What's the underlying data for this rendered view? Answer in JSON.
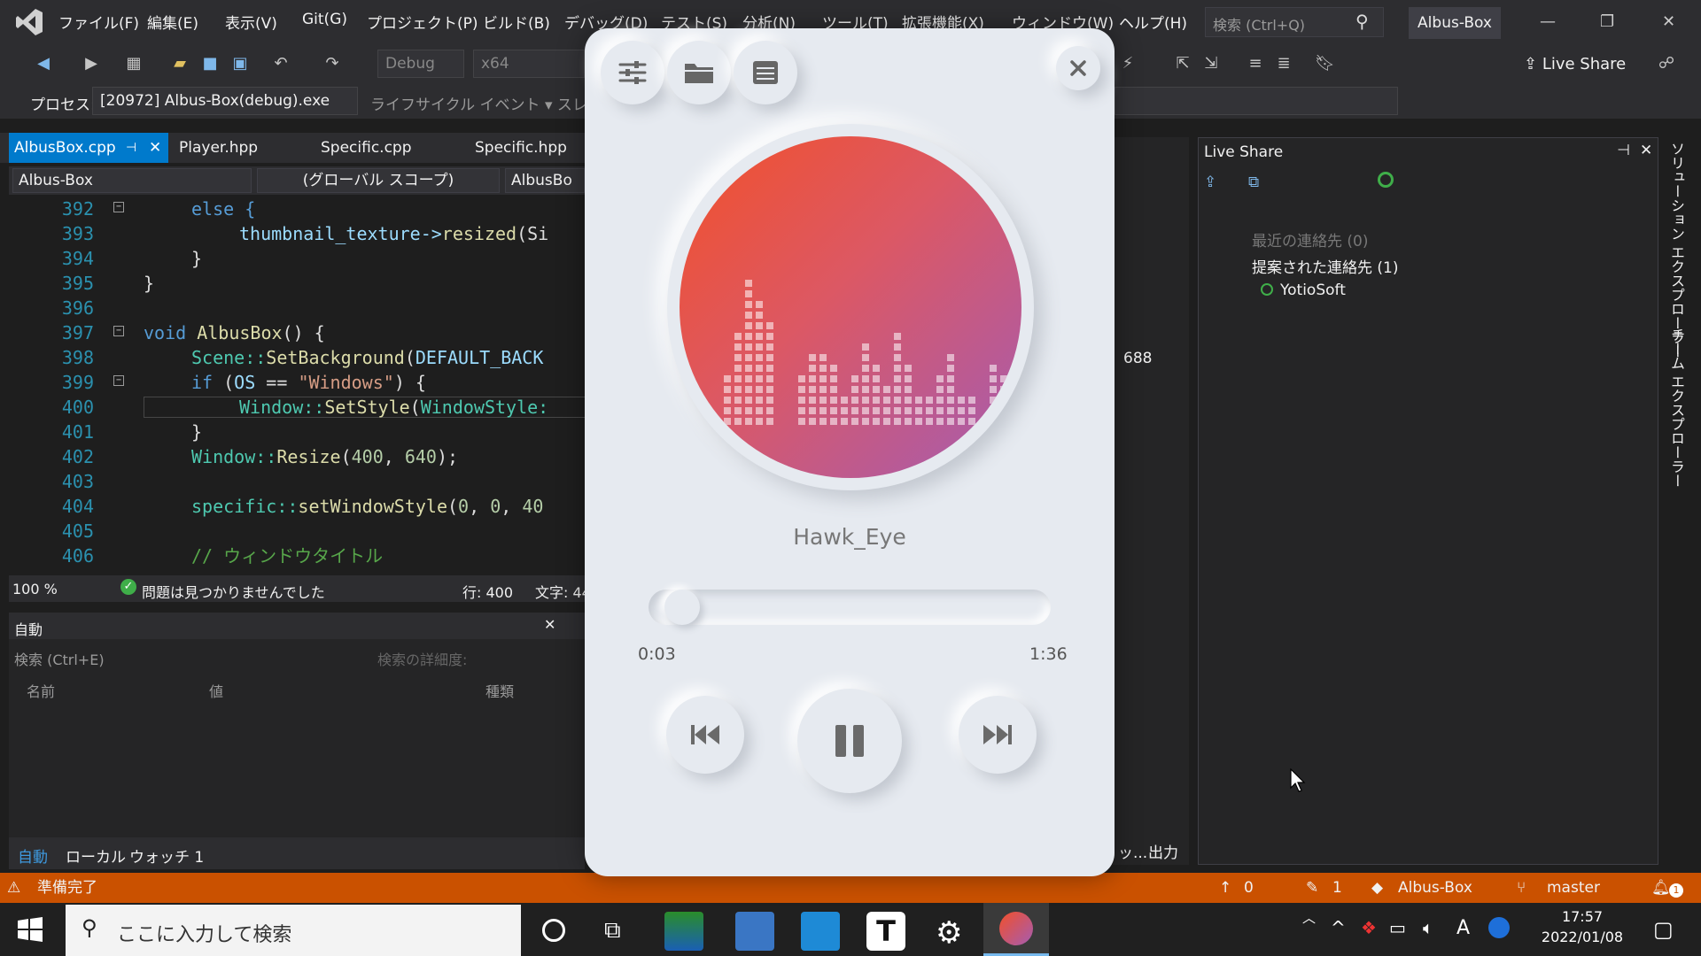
{
  "menu": [
    "ファイル(F)",
    "編集(E)",
    "表示(V)",
    "Git(G)",
    "プロジェクト(P)",
    "ビルド(B)",
    "デバッグ(D)",
    "テスト(S)",
    "分析(N)",
    "ツール(T)",
    "拡張機能(X)",
    "ウィンドウ(W)",
    "ヘルプ(H)"
  ],
  "search": {
    "placeholder": "検索 (Ctrl+Q)"
  },
  "solution_title": "Albus-Box",
  "toolbar": {
    "config": "Debug",
    "platform": "x64",
    "live_share": "Live Share"
  },
  "process": {
    "label": "プロセス:",
    "value": "[20972] Albus-Box(debug).exe",
    "lifecycle": "ライフサイクル イベント",
    "thread": "スレ"
  },
  "tabs": [
    "AlbusBox.cpp",
    "Player.hpp",
    "Specific.cpp",
    "Specific.hpp"
  ],
  "nav": {
    "project": "Albus-Box",
    "scope": "(グローバル スコープ)",
    "member": "AlbusBo"
  },
  "code": {
    "lines": [
      "392",
      "393",
      "394",
      "395",
      "396",
      "397",
      "398",
      "399",
      "400",
      "401",
      "402",
      "403",
      "404",
      "405",
      "406"
    ],
    "l392": "else {",
    "l393a": "thumbnail_texture->",
    "l393b": "resized",
    "l393c": "(Si",
    "l394": "}",
    "l395": "}",
    "l397a": "void ",
    "l397b": "AlbusBox",
    "l397c": "() {",
    "l398a": "Scene::",
    "l398b": "SetBackground",
    "l398c": "(",
    "l398d": "DEFAULT_BACK",
    "l399a": "if ",
    "l399b": "(",
    "l399c": "OS",
    "l399d": " == ",
    "l399e": "\"Windows\"",
    "l399f": ") {",
    "l400a": "Window::",
    "l400b": "SetStyle",
    "l400c": "(",
    "l400d": "WindowStyle:",
    "l401": "}",
    "l402a": "Window::",
    "l402b": "Resize",
    "l402c": "(",
    "l402d": "400",
    ", ": ", ",
    "l402e": "640",
    "l402f": ");",
    "l404a": "specific::",
    "l404b": "setWindowStyle",
    "l404c": "(",
    "l404d": "0",
    "l404e": "0",
    "l404f": "40",
    "l406": "// ウィンドウタイトル"
  },
  "editor_status": {
    "zoom": "100 %",
    "issues": "問題は見つかりませんでした",
    "line": "行: 400",
    "char": "文字: 44"
  },
  "autos": {
    "title": "自動",
    "search": "検索 (Ctrl+E)",
    "depth": "検索の詳細度:",
    "col_name": "名前",
    "col_value": "値",
    "col_type": "種類",
    "tabs": [
      "自動",
      "ローカル",
      "ウォッチ 1"
    ]
  },
  "mid": {
    "value": "688",
    "output": "出力",
    "more": "ッ..."
  },
  "live_share": {
    "title": "Live Share",
    "recent": "最近の連絡先 (0)",
    "suggested": "提案された連絡先 (1)",
    "contact": "YotioSoft"
  },
  "side_tabs": [
    "ソリューション エクスプローラー",
    "チーム エクスプローラー"
  ],
  "status": {
    "ready": "準備完了",
    "up": "0",
    "edits": "1",
    "project": "Albus-Box",
    "branch": "master",
    "notif": "1"
  },
  "taskbar": {
    "search": "ここに入力して検索",
    "time": "17:57",
    "date": "2022/01/08",
    "ime": "A"
  },
  "player": {
    "track": "Hawk_Eye",
    "elapsed": "0:03",
    "duration": "1:36",
    "progress": 0.03,
    "buttons": [
      "settings-icon",
      "folder-icon",
      "playlist-icon",
      "close-icon",
      "previous-icon",
      "pause-icon",
      "next-icon"
    ],
    "art_colors": [
      "#f2502a",
      "#dc5864",
      "#a45cb2"
    ]
  }
}
